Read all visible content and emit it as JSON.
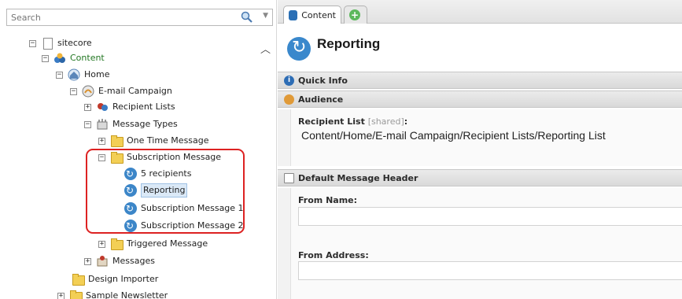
{
  "search": {
    "placeholder": "Search"
  },
  "tree": {
    "sitecore": "sitecore",
    "content": "Content",
    "home": "Home",
    "email_campaign": "E-mail Campaign",
    "recipient_lists": "Recipient Lists",
    "message_types": "Message Types",
    "one_time_message": "One Time Message",
    "subscription_message": "Subscription Message",
    "five_recipients": "5 recipients",
    "reporting": "Reporting",
    "subscription_message_1": "Subscription Message 1",
    "subscription_message_2": "Subscription Message 2",
    "triggered_message": "Triggered Message",
    "messages": "Messages",
    "design_importer": "Design Importer",
    "sample_newsletter": "Sample Newsletter"
  },
  "editor": {
    "tab_content": "Content",
    "title": "Reporting",
    "quick_info": "Quick Info",
    "audience": "Audience",
    "recipient_list_label": "Recipient List",
    "recipient_list_shared": "[shared]",
    "recipient_list_colon": ":",
    "recipient_list_value": "Content/Home/E-mail Campaign/Recipient Lists/Reporting List",
    "default_message_header": "Default Message Header",
    "from_name_label": "From Name:",
    "from_address_label": "From Address:"
  },
  "colors": {
    "highlight": "#dd2222",
    "selected_bg": "#dbe9f7",
    "content_green": "#227722"
  }
}
